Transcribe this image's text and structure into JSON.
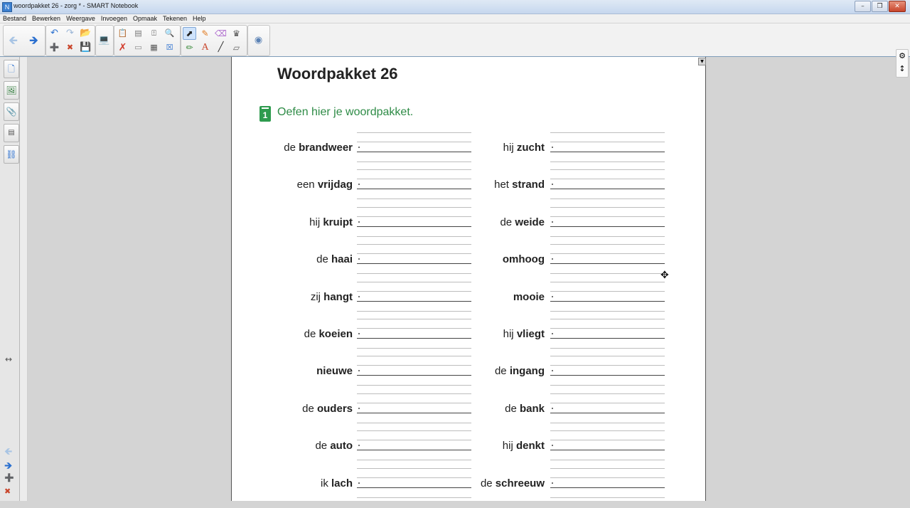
{
  "window": {
    "title": "woordpakket 26 - zorg * - SMART Notebook",
    "app_icon": "notebook-app-icon",
    "buttons": [
      "minimize",
      "restore",
      "close"
    ]
  },
  "menu": [
    "Bestand",
    "Bewerken",
    "Weergave",
    "Invoegen",
    "Opmaak",
    "Tekenen",
    "Help"
  ],
  "toolbar": {
    "icons": [
      "back-arrow-icon",
      "forward-arrow-icon",
      "undo-icon",
      "redo-icon",
      "open-folder-icon",
      "add-page-icon",
      "delete-page-icon",
      "save-icon",
      "screen-display-icon",
      "paste-icon",
      "delete-icon",
      "screen-shade-icon",
      "table-icon",
      "capture-icon",
      "select-pointer-icon",
      "pen-icon",
      "eraser-icon",
      "fill-icon",
      "magic-pen-icon",
      "text-icon",
      "line-icon",
      "shape-eraser-icon",
      "properties-icon",
      "settings-icon",
      "move-toolbar-icon"
    ]
  },
  "sidebar": {
    "tabs": [
      "page-sorter-icon",
      "gallery-icon",
      "attachments-icon",
      "properties-icon",
      "addons-icon"
    ]
  },
  "worksheet": {
    "title": "Woordpakket 26",
    "exercise_number": "1",
    "exercise_text": "Oefen hier je woordpakket.",
    "left_column": [
      {
        "pre": "de ",
        "word": "brandweer"
      },
      {
        "pre": "een ",
        "word": "vrijdag"
      },
      {
        "pre": "hij ",
        "word": "kruipt"
      },
      {
        "pre": "de ",
        "word": "haai"
      },
      {
        "pre": "zij ",
        "word": "hangt"
      },
      {
        "pre": "de ",
        "word": "koeien"
      },
      {
        "pre": "",
        "word": "nieuwe"
      },
      {
        "pre": "de ",
        "word": "ouders"
      },
      {
        "pre": "de ",
        "word": "auto"
      },
      {
        "pre": "ik ",
        "word": "lach"
      }
    ],
    "right_column": [
      {
        "pre": "hij ",
        "word": "zucht"
      },
      {
        "pre": "het ",
        "word": "strand"
      },
      {
        "pre": "de ",
        "word": "weide"
      },
      {
        "pre": "",
        "word": "omhoog"
      },
      {
        "pre": "",
        "word": "mooie"
      },
      {
        "pre": "hij ",
        "word": "vliegt"
      },
      {
        "pre": "de ",
        "word": "ingang"
      },
      {
        "pre": "de ",
        "word": "bank"
      },
      {
        "pre": "hij ",
        "word": "denkt"
      },
      {
        "pre": "de ",
        "word": "schreeuw"
      }
    ]
  },
  "colors": {
    "exercise_green": "#2e8b46",
    "toolbar_bg": "#f2f2f2",
    "canvas_bg": "#d4d4d4"
  }
}
